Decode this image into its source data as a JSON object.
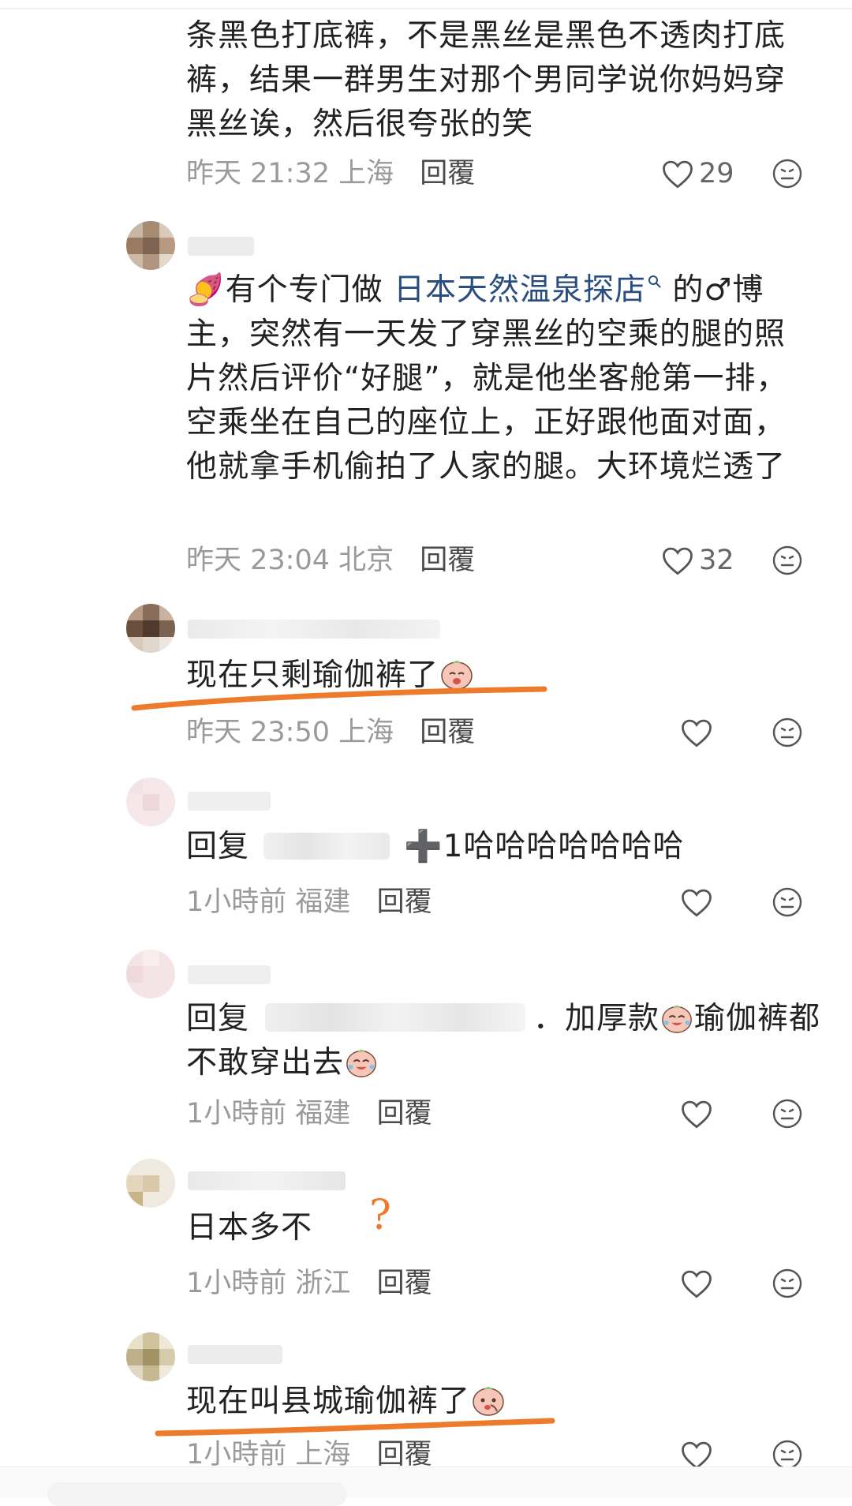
{
  "comments": [
    {
      "text": "条黑色打底裤，不是黑丝是黑色不透肉打底裤，结果一群男生对那个男同学说你妈妈穿黑丝诶，然后很夸张的笑",
      "time": "昨天 21:32",
      "location": "上海",
      "reply_label": "回覆",
      "likes": "29"
    },
    {
      "emoji": "🍠",
      "text_before": "有个专门做 ",
      "topic": "日本天然温泉探店",
      "topic_icon": "search-icon",
      "text_after": " 的♂博主，突然有一天发了穿黑丝的空乘的腿的照片然后评价“好腿”，就是他坐客舱第一排，空乘坐在自己的座位上，正好跟他面对面，他就拿手机偷拍了人家的腿。大环境烂透了",
      "time": "昨天 23:04",
      "location": "北京",
      "reply_label": "回覆",
      "likes": "32"
    },
    {
      "text": "现在只剩瑜伽裤了",
      "sticker": "crying-peach-sticker",
      "time": "昨天 23:50",
      "location": "上海",
      "reply_label": "回覆"
    },
    {
      "reply_prefix": "回复",
      "text": "➕1哈哈哈哈哈哈哈",
      "time": "1小時前",
      "location": "福建",
      "reply_label": "回覆"
    },
    {
      "reply_prefix": "回复",
      "text_part1": "．加厚款",
      "text_part2": "瑜伽裤都不敢穿出去",
      "sticker": "laughing-crying-peach-sticker",
      "time": "1小時前",
      "location": "福建",
      "reply_label": "回覆"
    },
    {
      "text": "日本多不",
      "annotation": "?",
      "time": "1小時前",
      "location": "浙江",
      "reply_label": "回覆"
    },
    {
      "text": "现在叫县城瑜伽裤了",
      "sticker": "shy-peach-sticker",
      "time": "1小時前",
      "location": "上海",
      "reply_label": "回覆"
    }
  ],
  "colors": {
    "text": "#222222",
    "meta": "#9a9a9a",
    "topic": "#2a4d7f",
    "highlight": "#ee7a2c"
  },
  "icons": {
    "like": "heart-outline-icon",
    "emoji": "neutral-face-icon"
  }
}
